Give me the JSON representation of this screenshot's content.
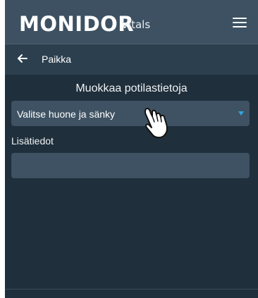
{
  "header": {
    "brand_main": "MONIDOR",
    "brand_sub": "Vitals",
    "menu_icon": "hamburger-menu-icon"
  },
  "subbar": {
    "back_icon": "arrow-left-icon",
    "title": "Paikka"
  },
  "main": {
    "page_title": "Muokkaa potilastietoja",
    "room_select": {
      "selected": "Valitse huone ja sänky",
      "caret_icon": "caret-down-icon"
    },
    "details": {
      "label": "Lisätiedot",
      "value": ""
    }
  },
  "colors": {
    "header_bg": "#3d5162",
    "app_bg": "#1f2f3b",
    "field_bg": "#3e5263",
    "accent": "#2ea8e0"
  },
  "cursor": "hand-pointer-icon"
}
